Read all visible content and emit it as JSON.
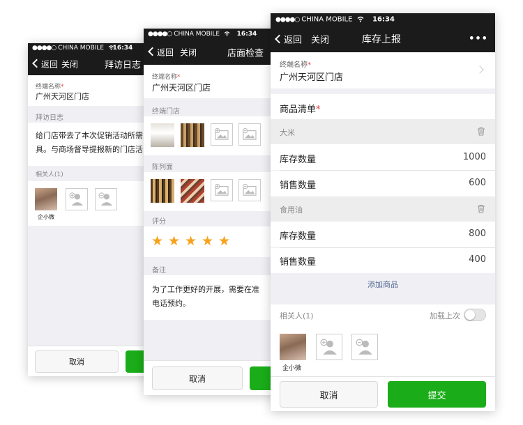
{
  "status": {
    "dots": "●●●●○",
    "carrier": "CHINA MOBILE",
    "wifi_icon": "wifi-icon",
    "time": "16:34"
  },
  "nav": {
    "back": "返回",
    "close": "关闭",
    "more": "•••"
  },
  "screen1": {
    "title": "拜访日志",
    "terminal_label": "终端名称",
    "terminal_value": "广州天河区门店",
    "log_label": "拜访日志",
    "log_text_1": "给门店带去了本次促销活动所需",
    "log_text_2": "具。与商场督导提报新的门店活",
    "related_label": "相关人(1)",
    "person_name": "企小微",
    "cancel": "取消"
  },
  "screen2": {
    "title": "店面检查",
    "terminal_label": "终端名称",
    "terminal_value": "广州天河区门店",
    "store_label": "终端门店",
    "display_label": "陈列面",
    "rating_label": "评分",
    "rating": 5,
    "rating_max": 5,
    "notes_label": "备注",
    "notes_text_1": "为了工作更好的开展，需要在准",
    "notes_text_2": "电话预约。",
    "cancel": "取消"
  },
  "screen3": {
    "title": "库存上报",
    "terminal_label": "终端名称",
    "terminal_value": "广州天河区门店",
    "goods_label": "商品清单",
    "products": [
      {
        "name": "大米",
        "stock_label": "库存数量",
        "stock_value": "1000",
        "sales_label": "销售数量",
        "sales_value": "600"
      },
      {
        "name": "食用油",
        "stock_label": "库存数量",
        "stock_value": "800",
        "sales_label": "销售数量",
        "sales_value": "400"
      }
    ],
    "add_product": "添加商品",
    "related_label": "相关人(1)",
    "load_last_label": "加载上次",
    "load_last_on": false,
    "person_name": "企小微",
    "cancel": "取消",
    "submit": "提交"
  },
  "colors": {
    "accent_green": "#1aad19",
    "star": "#f7a21b",
    "link_blue": "#576b95",
    "required_red": "#e64340"
  }
}
